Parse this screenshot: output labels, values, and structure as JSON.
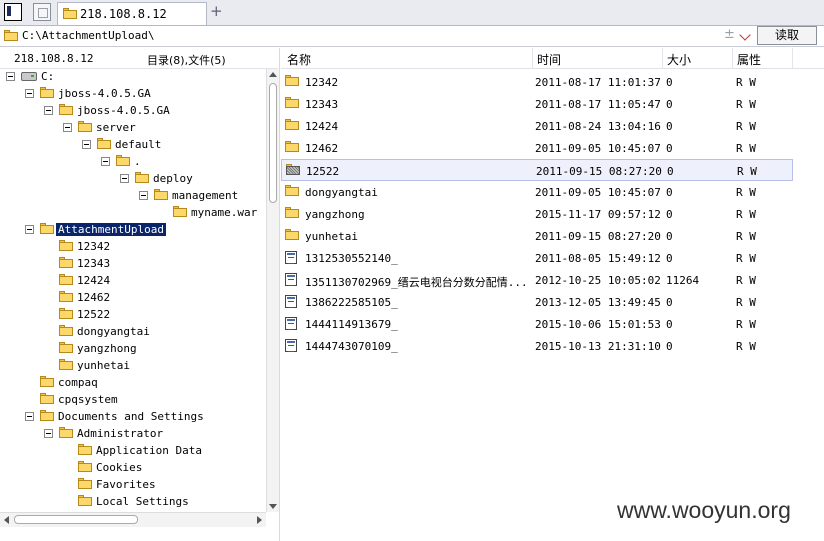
{
  "tab": {
    "label": "218.108.8.12"
  },
  "address": {
    "path": "C:\\AttachmentUpload\\",
    "read_label": "读取"
  },
  "left_header": {
    "host": "218.108.8.12",
    "count": "目录(8),文件(5)"
  },
  "tree": [
    {
      "label": "C:",
      "icon": "drive",
      "exp": true
    },
    {
      "label": "jboss-4.0.5.GA",
      "icon": "folder",
      "exp": true
    },
    {
      "label": "jboss-4.0.5.GA",
      "icon": "folder",
      "exp": true
    },
    {
      "label": "server",
      "icon": "folder",
      "exp": true
    },
    {
      "label": "default",
      "icon": "folder",
      "exp": true
    },
    {
      "label": ".",
      "icon": "folder",
      "exp": true
    },
    {
      "label": "deploy",
      "icon": "folder",
      "exp": true
    },
    {
      "label": "management",
      "icon": "folder",
      "exp": true
    },
    {
      "label": "myname.war",
      "icon": "folder",
      "exp": false
    },
    {
      "label": "AttachmentUpload",
      "icon": "folder",
      "exp": true,
      "selected": true
    },
    {
      "label": "12342",
      "icon": "folder",
      "exp": false
    },
    {
      "label": "12343",
      "icon": "folder",
      "exp": false
    },
    {
      "label": "12424",
      "icon": "folder",
      "exp": false
    },
    {
      "label": "12462",
      "icon": "folder",
      "exp": false
    },
    {
      "label": "12522",
      "icon": "folder",
      "exp": false
    },
    {
      "label": "dongyangtai",
      "icon": "folder",
      "exp": false
    },
    {
      "label": "yangzhong",
      "icon": "folder",
      "exp": false
    },
    {
      "label": "yunhetai",
      "icon": "folder",
      "exp": false
    },
    {
      "label": "compaq",
      "icon": "folder",
      "exp": false
    },
    {
      "label": "cpqsystem",
      "icon": "folder",
      "exp": false
    },
    {
      "label": "Documents and Settings",
      "icon": "folder",
      "exp": true
    },
    {
      "label": "Administrator",
      "icon": "folder",
      "exp": true
    },
    {
      "label": "Application Data",
      "icon": "folder",
      "exp": false
    },
    {
      "label": "Cookies",
      "icon": "folder",
      "exp": false
    },
    {
      "label": "Favorites",
      "icon": "folder",
      "exp": false
    },
    {
      "label": "Local Settings",
      "icon": "folder",
      "exp": false
    }
  ],
  "file_columns": {
    "name": "名称",
    "time": "时间",
    "size": "大小",
    "attr": "属性"
  },
  "files": [
    {
      "name": "12342",
      "time": "2011-08-17 11:01:37",
      "size": "0",
      "attr": "R W",
      "icon": "folder"
    },
    {
      "name": "12343",
      "time": "2011-08-17 11:05:47",
      "size": "0",
      "attr": "R W",
      "icon": "folder"
    },
    {
      "name": "12424",
      "time": "2011-08-24 13:04:16",
      "size": "0",
      "attr": "R W",
      "icon": "folder"
    },
    {
      "name": "12462",
      "time": "2011-09-05 10:45:07",
      "size": "0",
      "attr": "R W",
      "icon": "folder"
    },
    {
      "name": "12522",
      "time": "2011-09-15 08:27:20",
      "size": "0",
      "attr": "R W",
      "icon": "folder-hatched",
      "selected": true
    },
    {
      "name": "dongyangtai",
      "time": "2011-09-05 10:45:07",
      "size": "0",
      "attr": "R W",
      "icon": "folder"
    },
    {
      "name": "yangzhong",
      "time": "2015-11-17 09:57:12",
      "size": "0",
      "attr": "R W",
      "icon": "folder"
    },
    {
      "name": "yunhetai",
      "time": "2011-09-15 08:27:20",
      "size": "0",
      "attr": "R W",
      "icon": "folder"
    },
    {
      "name": "1312530552140_",
      "time": "2011-08-05 15:49:12",
      "size": "0",
      "attr": "R W",
      "icon": "doc"
    },
    {
      "name": "1351130702969_缙云电视台分数分配情...",
      "time": "2012-10-25 10:05:02",
      "size": "11264",
      "attr": "R W",
      "icon": "doc"
    },
    {
      "name": "1386222585105_",
      "time": "2013-12-05 13:49:45",
      "size": "0",
      "attr": "R W",
      "icon": "doc"
    },
    {
      "name": "1444114913679_",
      "time": "2015-10-06 15:01:53",
      "size": "0",
      "attr": "R W",
      "icon": "doc"
    },
    {
      "name": "1444743070109_",
      "time": "2015-10-13 21:31:10",
      "size": "0",
      "attr": "R W",
      "icon": "doc"
    }
  ],
  "watermark": "www.wooyun.org"
}
